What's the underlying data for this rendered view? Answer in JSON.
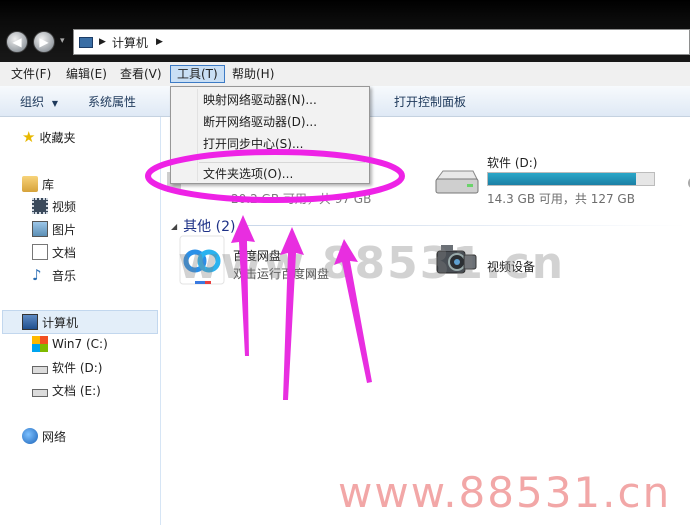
{
  "address": {
    "breadcrumb": "计算机"
  },
  "menubar": [
    {
      "label": "文件(F)"
    },
    {
      "label": "编辑(E)"
    },
    {
      "label": "查看(V)"
    },
    {
      "label": "工具(T)"
    },
    {
      "label": "帮助(H)"
    }
  ],
  "toolbar": {
    "organize": "组织",
    "system_properties": "系统属性",
    "open_control_panel": "打开控制面板"
  },
  "tools_menu": {
    "items": [
      {
        "label": "映射网络驱动器(N)..."
      },
      {
        "label": "断开网络驱动器(D)..."
      },
      {
        "label": "打开同步中心(S)..."
      },
      {
        "label": "文件夹选项(O)..."
      }
    ]
  },
  "sidebar": {
    "favorites": "收藏夹",
    "library": "库",
    "library_items": [
      {
        "label": "视频"
      },
      {
        "label": "图片"
      },
      {
        "label": "文档"
      },
      {
        "label": "音乐"
      }
    ],
    "computer": "计算机",
    "drives": [
      {
        "label": "Win7 (C:)"
      },
      {
        "label": "软件 (D:)"
      },
      {
        "label": "文档 (E:)"
      }
    ],
    "network": "网络"
  },
  "content": {
    "drive_c_space_partial": "20.2 GB 可用，共 97 GB",
    "drive_d": {
      "name": "软件 (D:)",
      "space": "14.3 GB 可用，共 127 GB",
      "used_fraction": 0.89
    },
    "others_group": "其他 (2)",
    "baidu": {
      "name": "百度网盘",
      "desc": "双击运行百度网盘"
    },
    "video_device": {
      "name": "视频设备"
    }
  },
  "watermark": {
    "center": "www.88531.cn",
    "bottom": "www.88531.cn"
  },
  "colors": {
    "highlight_ring": "#ee22e6",
    "arrow": "#e82ee0",
    "menu_highlight": "#c9dff5",
    "progress": "#26a0c4"
  }
}
